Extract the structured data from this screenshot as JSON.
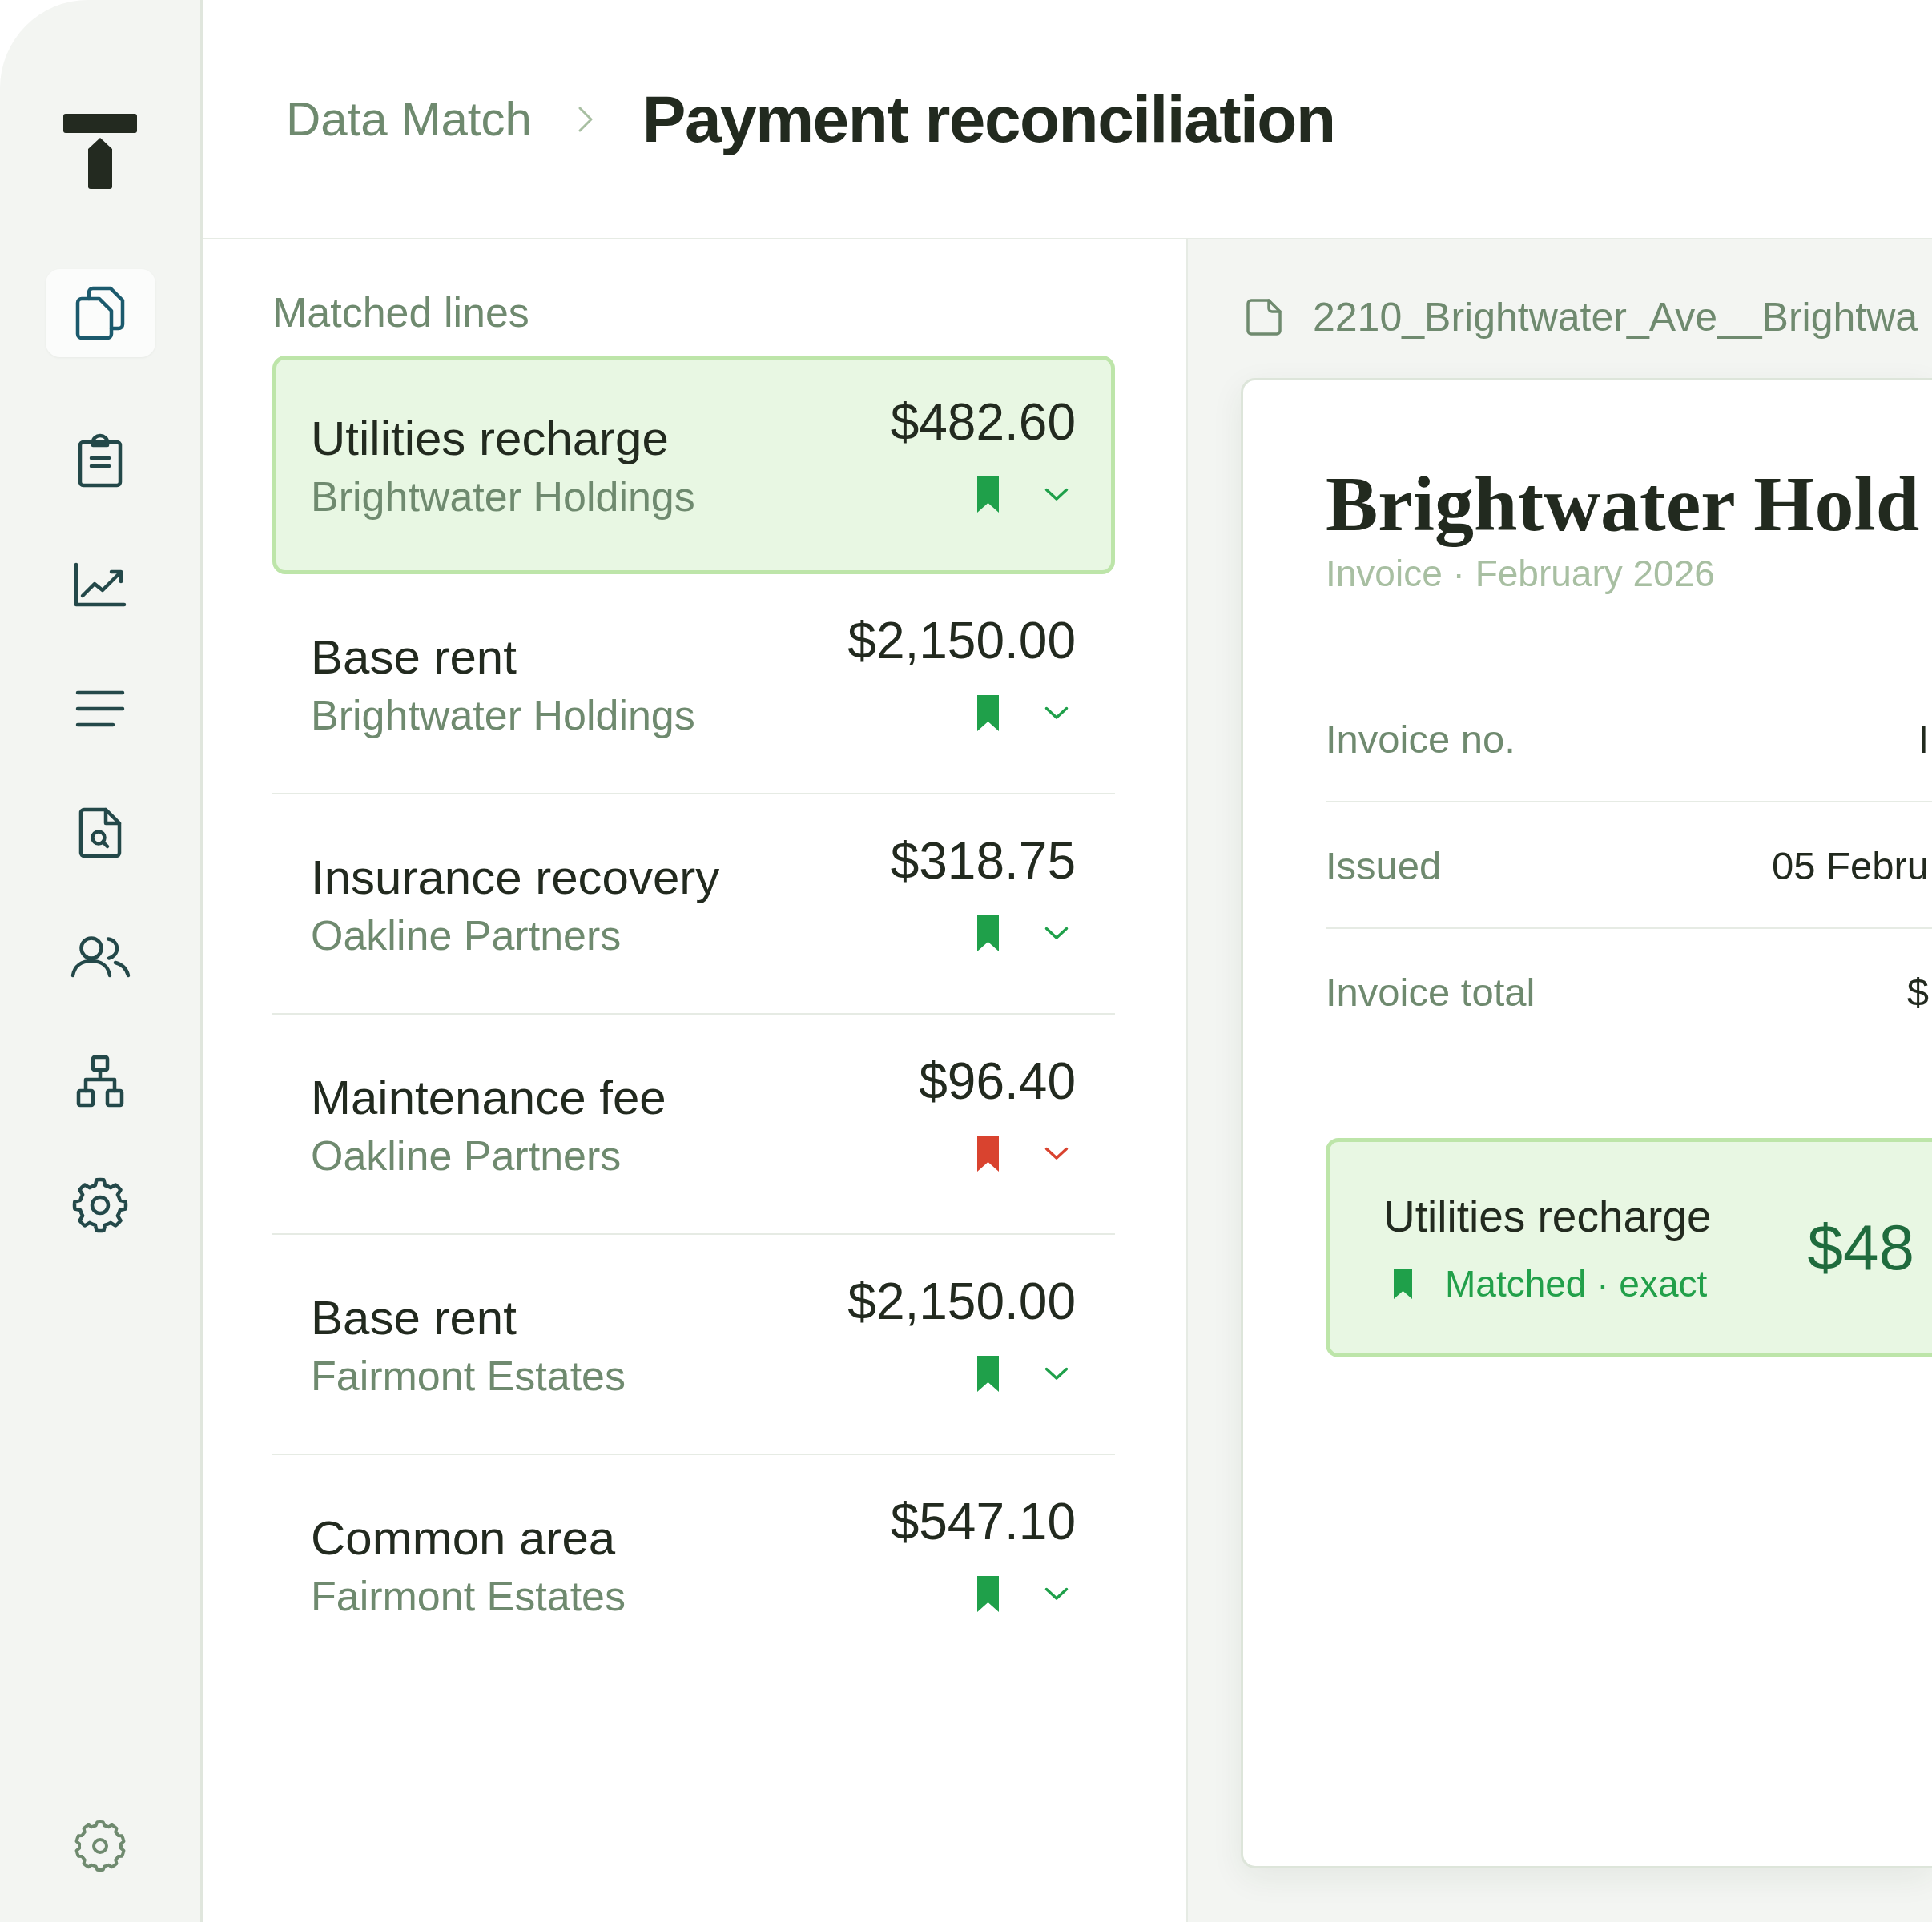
{
  "sidebar": {
    "nav": [
      {
        "kind": "documents",
        "selected": true
      },
      {
        "kind": "clipboard",
        "selected": false
      },
      {
        "kind": "chart",
        "selected": false
      },
      {
        "kind": "list",
        "selected": false
      },
      {
        "kind": "file-search",
        "selected": false
      },
      {
        "kind": "people",
        "selected": false
      },
      {
        "kind": "hierarchy",
        "selected": false
      },
      {
        "kind": "settings",
        "selected": false
      }
    ]
  },
  "header": {
    "breadcrumb": "Data Match",
    "title": "Payment reconciliation"
  },
  "lines": {
    "heading": "Matched lines",
    "items": [
      {
        "title": "Utilities recharge",
        "party": "Brightwater Holdings",
        "amount": "$482.60",
        "color": "#1fa04a",
        "selected": true
      },
      {
        "title": "Base rent",
        "party": "Brightwater Holdings",
        "amount": "$2,150.00",
        "color": "#1fa04a",
        "selected": false
      },
      {
        "title": "Insurance recovery",
        "party": "Oakline Partners",
        "amount": "$318.75",
        "color": "#1fa04a",
        "selected": false
      },
      {
        "title": "Maintenance fee",
        "party": "Oakline Partners",
        "amount": "$96.40",
        "color": "#d9432f",
        "selected": false
      },
      {
        "title": "Base rent",
        "party": "Fairmont Estates",
        "amount": "$2,150.00",
        "color": "#1fa04a",
        "selected": false
      },
      {
        "title": "Common area",
        "party": "Fairmont Estates",
        "amount": "$547.10",
        "color": "#1fa04a",
        "selected": false
      }
    ]
  },
  "document": {
    "filename": "2210_Brightwater_Ave__Brightwa",
    "title": "Brightwater Hold",
    "subtitle": "Invoice · February 2026",
    "fields": [
      {
        "label": "Invoice no.",
        "value": "I"
      },
      {
        "label": "Issued",
        "value": "05 Febru"
      },
      {
        "label": "Invoice total",
        "value": "$"
      }
    ],
    "match": {
      "title": "Utilities recharge",
      "status": "Matched · exact",
      "amount": "$48"
    }
  }
}
